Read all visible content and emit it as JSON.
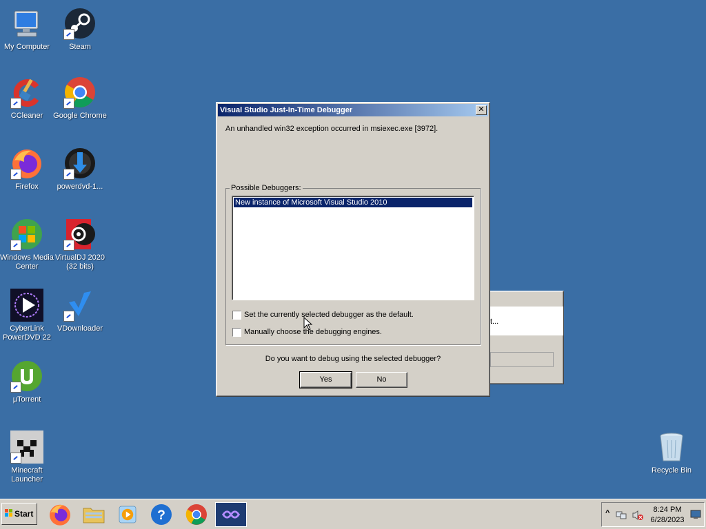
{
  "desktop": {
    "icons": [
      {
        "label": "My Computer"
      },
      {
        "label": "Steam"
      },
      {
        "label": "CCleaner"
      },
      {
        "label": "Google Chrome"
      },
      {
        "label": "Firefox"
      },
      {
        "label": "powerdvd-1..."
      },
      {
        "label": "Windows Media Center"
      },
      {
        "label": "VirtualDJ 2020 (32 bits)"
      },
      {
        "label": "CyberLink PowerDVD 22"
      },
      {
        "label": "VDownloader"
      },
      {
        "label": "µTorrent"
      },
      {
        "label": "Minecraft Launcher"
      },
      {
        "label": "Recycle Bin"
      }
    ]
  },
  "background_window": {
    "text": "t..."
  },
  "dialog": {
    "title": "Visual Studio Just-In-Time Debugger",
    "close_label": "✕",
    "message": "An unhandled win32 exception occurred in msiexec.exe [3972].",
    "group_label": "Possible Debuggers:",
    "debuggers": [
      "New instance of Microsoft Visual Studio 2010"
    ],
    "checkbox_default": "Set the currently selected debugger as the default.",
    "checkbox_manual": "Manually choose the debugging engines.",
    "question": "Do you want to debug using the selected debugger?",
    "yes_label": "Yes",
    "no_label": "No"
  },
  "taskbar": {
    "start_label": "Start",
    "clock_time": "8:24 PM",
    "clock_date": "6/28/2023",
    "tray_chevron": "^"
  },
  "colors": {
    "desktop": "#3a6ea5",
    "selection": "#0a246a",
    "titlebar_start": "#0a246a",
    "titlebar_end": "#a6caf0"
  }
}
